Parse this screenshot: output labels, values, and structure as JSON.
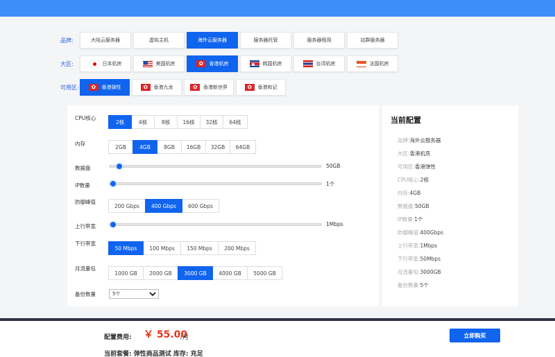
{
  "filters": {
    "category": {
      "label": "品牌:",
      "options": [
        "大陆云服务器",
        "虚拟主机",
        "海外云服务器",
        "服务器托管",
        "服务器租用",
        "站群服务器"
      ],
      "selected": "海外云服务器"
    },
    "region": {
      "label": "大区:",
      "options": [
        {
          "label": "日本机房",
          "flag": "jp"
        },
        {
          "label": "美国机房",
          "flag": "us"
        },
        {
          "label": "香港机房",
          "flag": "hk"
        },
        {
          "label": "韩国机房",
          "flag": "kp"
        },
        {
          "label": "台湾机房",
          "flag": "th"
        },
        {
          "label": "法国机房",
          "flag": "id"
        }
      ],
      "selected": "香港机房"
    },
    "zone": {
      "label": "可用区:",
      "options": [
        {
          "label": "香港弹性",
          "flag": "hk"
        },
        {
          "label": "香港九龙",
          "flag": "hk"
        },
        {
          "label": "香港新世界",
          "flag": "hk"
        },
        {
          "label": "香港和记",
          "flag": "hk"
        }
      ],
      "selected": "香港弹性"
    }
  },
  "config": {
    "cpu": {
      "label": "CPU核心",
      "options": [
        "2核",
        "4核",
        "8核",
        "16核",
        "32核",
        "64核"
      ],
      "selected": "2核"
    },
    "memory": {
      "label": "内存",
      "options": [
        "2GB",
        "4GB",
        "8GB",
        "16GB",
        "32GB",
        "64GB"
      ],
      "selected": "4GB"
    },
    "disk": {
      "label": "数据盘",
      "value": "50GB",
      "level": 0.03
    },
    "ip": {
      "label": "IP数量",
      "value": "1个",
      "level": 0.0
    },
    "ddos": {
      "label": "防御峰值",
      "options": [
        "200 Gbps",
        "400 Gbps",
        "600 Gbps"
      ],
      "selected": "400 Gbps"
    },
    "upload": {
      "label": "上行带宽",
      "value": "1Mbps",
      "level": 0.0
    },
    "download": {
      "label": "下行带宽",
      "options": [
        "50 Mbps",
        "100 Mbps",
        "150 Mbps",
        "200 Mbps"
      ],
      "selected": "50 Mbps"
    },
    "traffic": {
      "label": "月流量包",
      "options": [
        "1000 GB",
        "2000 GB",
        "3000 GB",
        "4000 GB",
        "5000 GB"
      ],
      "selected": "3000 GB"
    },
    "backup": {
      "label": "备份数量",
      "options": [
        "5个"
      ],
      "selected": "5个"
    }
  },
  "summary": {
    "title": "当前配置",
    "rows": [
      {
        "key": "品牌:",
        "value": "海外云服务器"
      },
      {
        "key": "大区:",
        "value": "香港机房"
      },
      {
        "key": "可用区:",
        "value": "香港弹性"
      },
      {
        "key": "CPU核心:",
        "value": "2核"
      },
      {
        "key": "内存:",
        "value": "4GB"
      },
      {
        "key": "数据盘:",
        "value": "50GB"
      },
      {
        "key": "IP数量:",
        "value": "1个"
      },
      {
        "key": "防御峰值:",
        "value": "400Gbps"
      },
      {
        "key": "上行带宽:",
        "value": "1Mbps"
      },
      {
        "key": "下行带宽:",
        "value": "50Mbps"
      },
      {
        "key": "月流量包:",
        "value": "3000GB"
      },
      {
        "key": "备份数量:",
        "value": "5个"
      }
    ]
  },
  "footer": {
    "fee_label": "配置费用:",
    "price": "￥ 55.00",
    "unit": "/月",
    "package": "当前套餐: 弹性商品测试 库存: 充足",
    "buy_label": "立即购买"
  },
  "colors": {
    "accent": "#1064ee",
    "topbar": "#3d8ef8",
    "price": "#e8341c"
  }
}
